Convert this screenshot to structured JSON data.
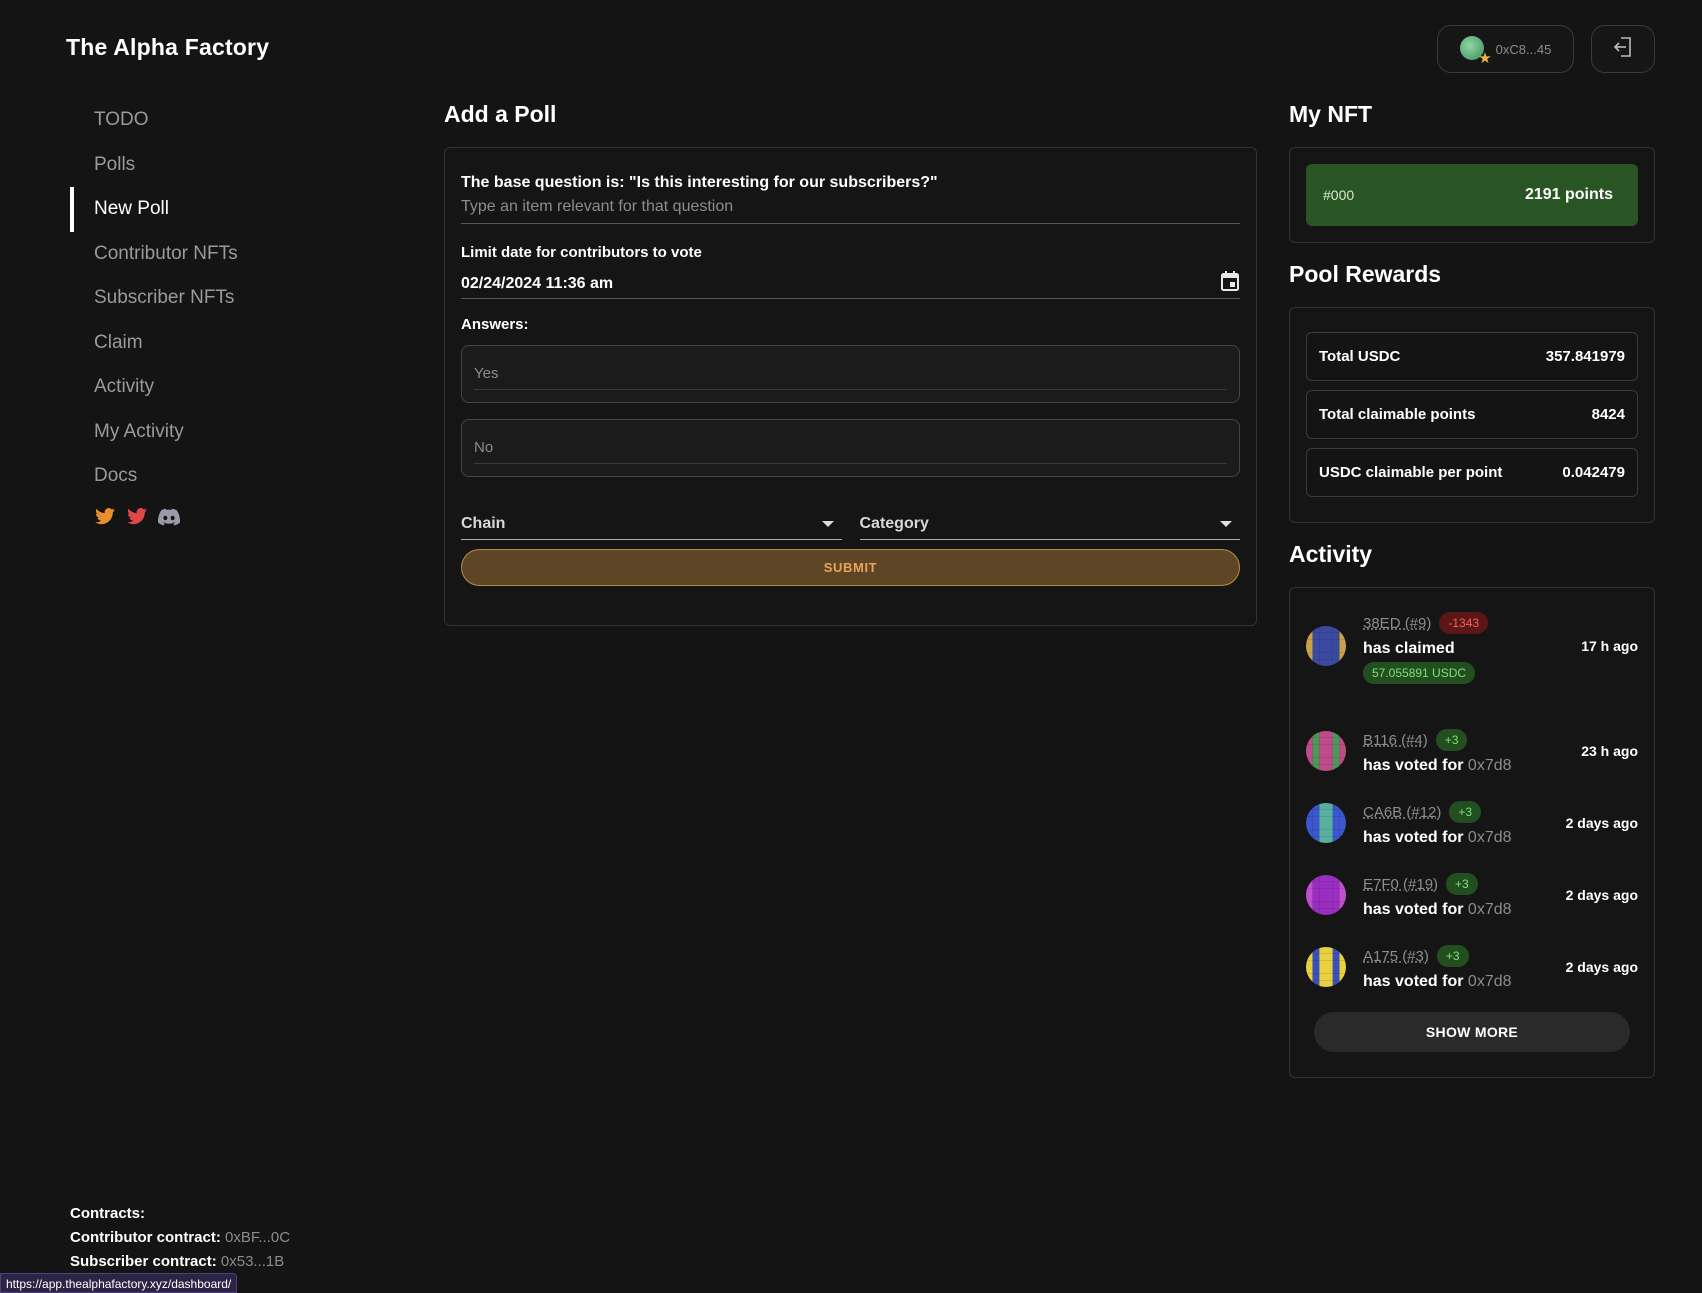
{
  "header": {
    "app_title": "The Alpha Factory",
    "wallet_address": "0xC8...45",
    "logout_icon": "logout-icon"
  },
  "sidebar": {
    "items": [
      {
        "label": "TODO",
        "active": false
      },
      {
        "label": "Polls",
        "active": false
      },
      {
        "label": "New Poll",
        "active": true
      },
      {
        "label": "Contributor NFTs",
        "active": false
      },
      {
        "label": "Subscriber NFTs",
        "active": false
      },
      {
        "label": "Claim",
        "active": false
      },
      {
        "label": "Activity",
        "active": false
      },
      {
        "label": "My Activity",
        "active": false
      },
      {
        "label": "Docs",
        "active": false
      }
    ],
    "socials": [
      "twitter-icon",
      "twitter-icon",
      "discord-icon"
    ]
  },
  "contracts": {
    "heading": "Contracts:",
    "contributor_label": "Contributor contract:",
    "contributor_value": "0xBF...0C",
    "subscriber_label": "Subscriber contract:",
    "subscriber_value": "0x53...1B"
  },
  "status_url": "https://app.thealphafactory.xyz/dashboard/",
  "poll_form": {
    "title": "Add a Poll",
    "question_label": "The base question is: \"Is this interesting for our subscribers?\"",
    "question_placeholder": "Type an item relevant for that question",
    "date_label": "Limit date for contributors to vote",
    "date_value": "02/24/2024 11:36 am",
    "answers_label": "Answers:",
    "answers": [
      "Yes",
      "No"
    ],
    "chain_label": "Chain",
    "category_label": "Category",
    "submit_label": "SUBMIT"
  },
  "my_nft": {
    "title": "My NFT",
    "id": "#000",
    "points": "2191 points"
  },
  "pool_rewards": {
    "title": "Pool Rewards",
    "rows": [
      {
        "label": "Total USDC",
        "value": "357.841979"
      },
      {
        "label": "Total claimable points",
        "value": "8424"
      },
      {
        "label": "USDC claimable per point",
        "value": "0.042479"
      }
    ]
  },
  "activity": {
    "title": "Activity",
    "items": [
      {
        "user": "38ED (#9)",
        "badge": "-1343",
        "badge_color": "red",
        "action": "has claimed",
        "target": "",
        "amount": "57.055891 USDC",
        "time": "17 h ago",
        "avatar_colors": [
          "#3a4aa0",
          "#c9a24a"
        ]
      },
      {
        "user": "B116 (#4)",
        "badge": "+3",
        "badge_color": "green",
        "action": "has voted for",
        "target": "0x7d8",
        "amount": "",
        "time": "23 h ago",
        "avatar_colors": [
          "#c04b8a",
          "#4a9a55"
        ]
      },
      {
        "user": "CA6B (#12)",
        "badge": "+3",
        "badge_color": "green",
        "action": "has voted for",
        "target": "0x7d8",
        "amount": "",
        "time": "2 days ago",
        "avatar_colors": [
          "#3a56d0",
          "#5ab0a0"
        ]
      },
      {
        "user": "E7F0 (#19)",
        "badge": "+3",
        "badge_color": "green",
        "action": "has voted for",
        "target": "0x7d8",
        "amount": "",
        "time": "2 days ago",
        "avatar_colors": [
          "#9a2ec0",
          "#c050d0"
        ]
      },
      {
        "user": "A175 (#3)",
        "badge": "+3",
        "badge_color": "green",
        "action": "has voted for",
        "target": "0x7d8",
        "amount": "",
        "time": "2 days ago",
        "avatar_colors": [
          "#e8d040",
          "#3a50c0"
        ]
      }
    ],
    "show_more_label": "SHOW MORE"
  }
}
